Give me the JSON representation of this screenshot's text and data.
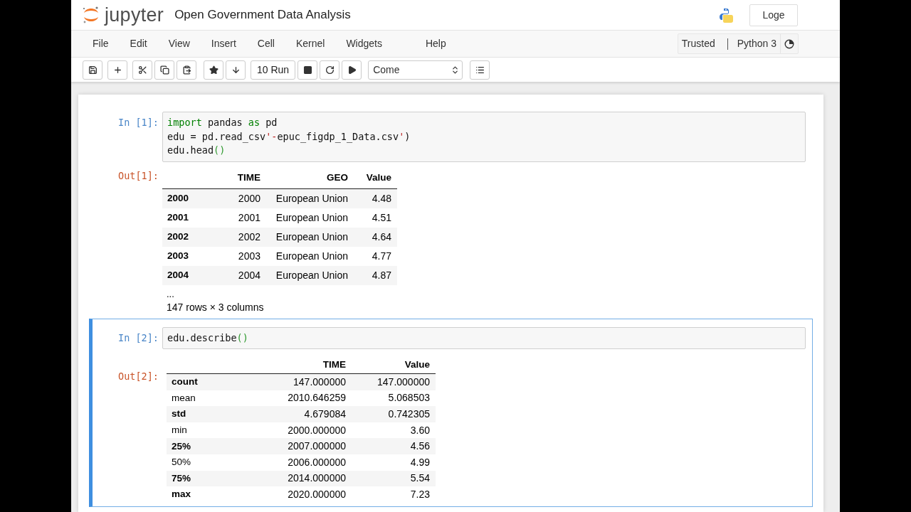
{
  "header": {
    "logo_text": "jupyter",
    "notebook_title": "Open Government Data Analysis",
    "logout_button": "Loge"
  },
  "menubar": {
    "items": [
      "File",
      "Edit",
      "View",
      "Insert",
      "Cell",
      "Kernel",
      "Widgets",
      "Help"
    ],
    "trusted": "Trusted",
    "kernel_name": "Python 3"
  },
  "toolbar": {
    "run_button": "10 Run",
    "cell_type": "Come"
  },
  "cells": [
    {
      "selected": false,
      "input_prompt": "In [1]:",
      "code_lines": [
        [
          {
            "kind": "keyword",
            "text": "import"
          },
          {
            "kind": "plain",
            "text": " pandas "
          },
          {
            "kind": "keyword",
            "text": "as"
          },
          {
            "kind": "plain",
            "text": " pd"
          }
        ],
        [
          {
            "kind": "plain",
            "text": "edu = pd.read_csv"
          },
          {
            "kind": "string",
            "text": "'-"
          },
          {
            "kind": "plain",
            "text": "epuc_figdp_1_Data.csv"
          },
          {
            "kind": "string",
            "text": "'"
          },
          {
            "kind": "plain",
            "text": ")"
          }
        ],
        [
          {
            "kind": "plain",
            "text": "edu.head"
          },
          {
            "kind": "bracket",
            "text": "()"
          }
        ]
      ],
      "output_prompt": "Out[1]:",
      "output": {
        "kind": "preview",
        "columns": [
          "TIME",
          "GEO",
          "Value"
        ],
        "rows": [
          {
            "index": "2000",
            "bold": true,
            "values": [
              "2000",
              "European Union",
              "4.48"
            ]
          },
          {
            "index": "2001",
            "bold": true,
            "values": [
              "2001",
              "European Union",
              "4.51"
            ]
          },
          {
            "index": "2002",
            "bold": true,
            "values": [
              "2002",
              "European Union",
              "4.64"
            ]
          },
          {
            "index": "2003",
            "bold": true,
            "values": [
              "2003",
              "European Union",
              "4.77"
            ]
          },
          {
            "index": "2004",
            "bold": true,
            "values": [
              "2004",
              "European Union",
              "4.87"
            ]
          }
        ],
        "ellipsis": "...",
        "shape": "147 rows × 3 columns"
      }
    },
    {
      "selected": true,
      "input_prompt": "In [2]:",
      "code_lines": [
        [
          {
            "kind": "plain",
            "text": "edu.describe"
          },
          {
            "kind": "bracket",
            "text": "()"
          }
        ]
      ],
      "output_prompt": "Out[2]:",
      "output": {
        "kind": "summary",
        "columns": [
          "TIME",
          "Value"
        ],
        "rows": [
          {
            "index": "count",
            "bold": true,
            "values": [
              "147.000000",
              "147.000000"
            ]
          },
          {
            "index": "mean",
            "bold": false,
            "values": [
              "2010.646259",
              "5.068503"
            ]
          },
          {
            "index": "std",
            "bold": true,
            "values": [
              "4.679084",
              "0.742305"
            ]
          },
          {
            "index": "min",
            "bold": false,
            "values": [
              "2000.000000",
              "3.60"
            ]
          },
          {
            "index": "25%",
            "bold": true,
            "values": [
              "2007.000000",
              "4.56"
            ]
          },
          {
            "index": "50%",
            "bold": false,
            "values": [
              "2006.000000",
              "4.99"
            ]
          },
          {
            "index": "75%",
            "bold": true,
            "values": [
              "2014.000000",
              "5.54"
            ]
          },
          {
            "index": "max",
            "bold": true,
            "values": [
              "2020.000000",
              "7.23"
            ]
          }
        ]
      }
    }
  ]
}
